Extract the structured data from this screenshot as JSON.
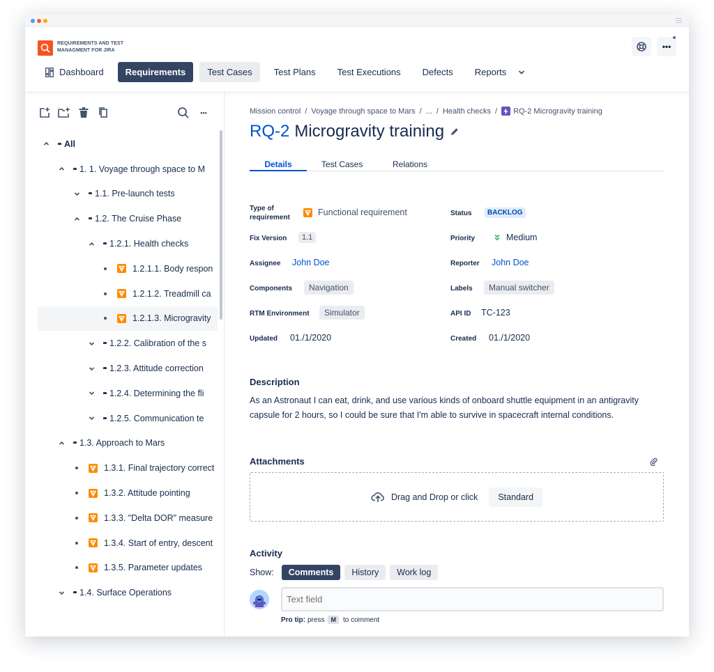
{
  "window": {
    "dots": [
      "#4c9aff",
      "#ff5630",
      "#ffab00"
    ]
  },
  "app": {
    "name": "REQUIREMENTS AND TEST MANAGMENT FOR JIRA"
  },
  "header": {
    "help_icon": "lifebuoy-icon",
    "more_icon": "more-icon",
    "more_label": "•••"
  },
  "nav": {
    "dashboard": "Dashboard",
    "requirements": "Requirements",
    "test_cases": "Test Cases",
    "test_plans": "Test Plans",
    "test_executions": "Test Executions",
    "defects": "Defects",
    "reports": "Reports"
  },
  "sidebar": {
    "more_label": "•••",
    "tree": [
      {
        "label": "All",
        "level": 0,
        "kind": "folder",
        "state": "expanded",
        "bold": true
      },
      {
        "label": "1. 1. Voyage through space to M",
        "level": 1,
        "kind": "folder",
        "state": "expanded"
      },
      {
        "label": "1.1. Pre-launch tests",
        "level": 2,
        "kind": "folder",
        "state": "collapsed"
      },
      {
        "label": "1.2. The Cruise Phase",
        "level": 2,
        "kind": "folder",
        "state": "expanded"
      },
      {
        "label": "1.2.1. Health checks",
        "level": 3,
        "kind": "folder",
        "state": "expanded"
      },
      {
        "label": "1.2.1.1. Body respon",
        "level": 4,
        "kind": "req",
        "state": "leaf"
      },
      {
        "label": "1.2.1.2. Treadmill ca",
        "level": 4,
        "kind": "req",
        "state": "leaf"
      },
      {
        "label": "1.2.1.3. Microgravity",
        "level": 4,
        "kind": "req",
        "state": "leaf",
        "selected": true
      },
      {
        "label": "1.2.2. Calibration of the s",
        "level": 3,
        "kind": "folder",
        "state": "collapsed"
      },
      {
        "label": "1.2.3. Attitude correction",
        "level": 3,
        "kind": "folder",
        "state": "collapsed"
      },
      {
        "label": "1.2.4. Determining the fli",
        "level": 3,
        "kind": "folder",
        "state": "collapsed"
      },
      {
        "label": "1.2.5. Communication te",
        "level": 3,
        "kind": "folder",
        "state": "collapsed"
      },
      {
        "label": "1.3. Approach to Mars",
        "level": 1,
        "kind": "folder",
        "state": "expanded"
      },
      {
        "label": "1.3.1. Final trajectory correct",
        "level": 2,
        "kind": "req",
        "state": "leaf"
      },
      {
        "label": "1.3.2. Attitude pointing",
        "level": 2,
        "kind": "req",
        "state": "leaf"
      },
      {
        "label": "1.3.3. \"Delta DOR\" measure",
        "level": 2,
        "kind": "req",
        "state": "leaf"
      },
      {
        "label": "1.3.4. Start of entry, descent",
        "level": 2,
        "kind": "req",
        "state": "leaf"
      },
      {
        "label": "1.3.5. Parameter updates",
        "level": 2,
        "kind": "req",
        "state": "leaf"
      },
      {
        "label": "1.4. Surface Operations",
        "level": 1,
        "kind": "folder",
        "state": "collapsed"
      }
    ]
  },
  "breadcrumb": {
    "items": [
      "Mission control",
      "Voyage through space to Mars",
      "...",
      "Health checks"
    ],
    "sep": "/",
    "current": "RQ-2 Microgravity training"
  },
  "issue": {
    "key": "RQ-2",
    "title": "Microgravity training"
  },
  "tabs": {
    "details": "Details",
    "test_cases": "Test Cases",
    "relations": "Relations"
  },
  "fields": {
    "type_label": "Type of requirement",
    "type_value": "Functional requirement",
    "status_label": "Status",
    "status_value": "BACKLOG",
    "fix_version_label": "Fix Version",
    "fix_version_value": "1.1",
    "priority_label": "Priority",
    "priority_value": "Medium",
    "assignee_label": "Assignee",
    "assignee_value": "John Doe",
    "reporter_label": "Reporter",
    "reporter_value": "John Doe",
    "components_label": "Components",
    "components_value": "Navigation",
    "labels_label": "Labels",
    "labels_value": "Manual switcher",
    "rtm_env_label": "RTM Environment",
    "rtm_env_value": "Simulator",
    "api_id_label": "API ID",
    "api_id_value": "TC-123",
    "updated_label": "Updated",
    "updated_value": "01./1/2020",
    "created_label": "Created",
    "created_value": "01./1/2020"
  },
  "description": {
    "heading": "Description",
    "text": "As an Astronaut I can eat, drink, and use various kinds of onboard shuttle equipment in an antigravity capsule for 2 hours, so I could be sure that I'm able to survive in spacecraft internal conditions."
  },
  "attachments": {
    "heading": "Attachments",
    "drop_text": "Drag and Drop or click",
    "button": "Standard"
  },
  "activity": {
    "heading": "Activity",
    "show_label": "Show:",
    "comments": "Comments",
    "history": "History",
    "worklog": "Work log",
    "placeholder": "Text field",
    "protip_bold": "Pro tip:",
    "protip_press": "press",
    "protip_key": "M",
    "protip_rest": "to comment"
  },
  "colors": {
    "accent": "#0052cc",
    "nav_active": "#344563",
    "brand": "#f4541d",
    "req_icon": "#ff8b00"
  }
}
